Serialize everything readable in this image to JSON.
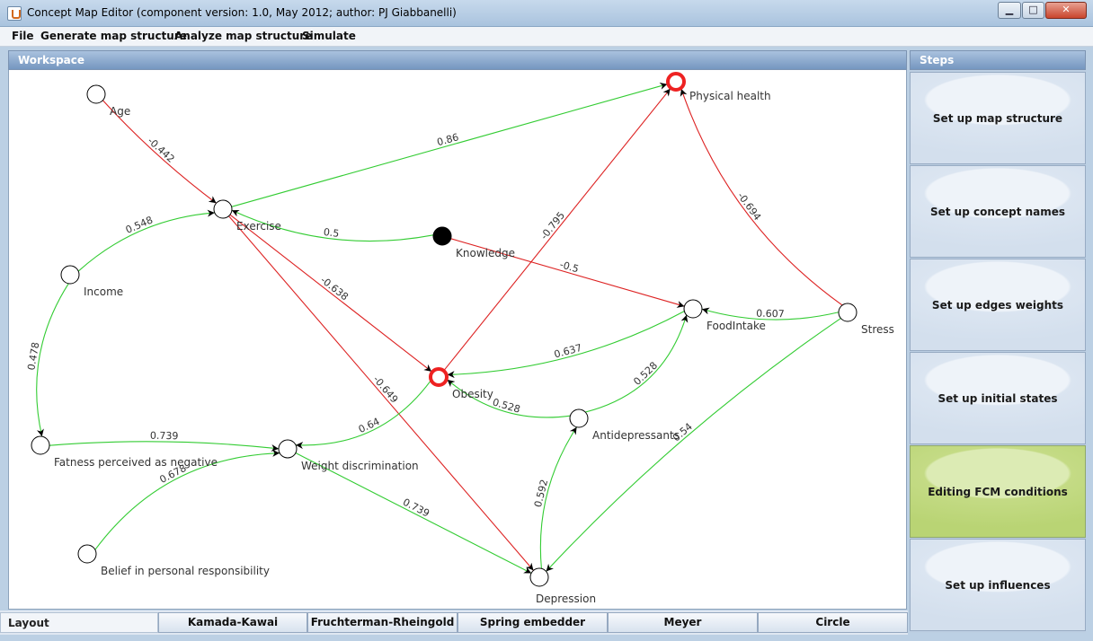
{
  "window": {
    "title": "Concept Map Editor (component version: 1.0, May 2012; author: PJ Giabbanelli)",
    "minimize_glyph": "▁",
    "maximize_glyph": "□",
    "close_glyph": "✕"
  },
  "menu": [
    "File",
    "Generate map structure",
    "Analyze map structure",
    "Simulate"
  ],
  "workspace": {
    "title": "Workspace"
  },
  "steps": {
    "title": "Steps",
    "items": [
      {
        "label": "Set up map structure",
        "active": false
      },
      {
        "label": "Set up concept names",
        "active": false
      },
      {
        "label": "Set up edges weights",
        "active": false
      },
      {
        "label": "Set up initial states",
        "active": false
      },
      {
        "label": "Editing FCM conditions",
        "active": true
      },
      {
        "label": "Set up influences",
        "active": false
      }
    ]
  },
  "layout": {
    "label": "Layout",
    "buttons": [
      "Kamada-Kawai",
      "Fruchterman-Rheingold",
      "Spring embedder",
      "Meyer",
      "Circle"
    ]
  },
  "colors": {
    "positive_edge": "#33cc33",
    "negative_edge": "#dd2222",
    "highlight_node": "#ee2222",
    "active_step": "#c4db85"
  },
  "concept_map": {
    "nodes": [
      {
        "id": "age",
        "label": "Age",
        "style": "normal"
      },
      {
        "id": "exercise",
        "label": "Exercise",
        "style": "normal"
      },
      {
        "id": "income",
        "label": "Income",
        "style": "normal"
      },
      {
        "id": "knowledge",
        "label": "Knowledge",
        "style": "filled"
      },
      {
        "id": "physical_health",
        "label": "Physical health",
        "style": "highlight"
      },
      {
        "id": "foodintake",
        "label": "FoodIntake",
        "style": "normal"
      },
      {
        "id": "stress",
        "label": "Stress",
        "style": "normal"
      },
      {
        "id": "obesity",
        "label": "Obesity",
        "style": "highlight"
      },
      {
        "id": "antidepressants",
        "label": "Antidepressants",
        "style": "normal"
      },
      {
        "id": "fatness",
        "label": "Fatness perceived as negative",
        "style": "normal"
      },
      {
        "id": "weight_discrimination",
        "label": "Weight discrimination",
        "style": "normal"
      },
      {
        "id": "belief",
        "label": "Belief in personal responsibility",
        "style": "normal"
      },
      {
        "id": "depression",
        "label": "Depression",
        "style": "normal"
      }
    ],
    "edges": [
      {
        "from": "age",
        "to": "exercise",
        "weight": "-0.442",
        "sign": "negative"
      },
      {
        "from": "exercise",
        "to": "physical_health",
        "weight": "0.86",
        "sign": "positive"
      },
      {
        "from": "knowledge",
        "to": "exercise",
        "weight": "0.5",
        "sign": "positive"
      },
      {
        "from": "income",
        "to": "exercise",
        "weight": "0.548",
        "sign": "positive"
      },
      {
        "from": "income",
        "to": "fatness",
        "weight": "0.478",
        "sign": "positive"
      },
      {
        "from": "exercise",
        "to": "obesity",
        "weight": "-0.638",
        "sign": "negative"
      },
      {
        "from": "exercise",
        "to": "depression",
        "weight": "-0.649",
        "sign": "negative"
      },
      {
        "from": "obesity",
        "to": "physical_health",
        "weight": "-0.795",
        "sign": "negative"
      },
      {
        "from": "stress",
        "to": "physical_health",
        "weight": "-0.694",
        "sign": "negative"
      },
      {
        "from": "knowledge",
        "to": "foodintake",
        "weight": "-0.5",
        "sign": "negative"
      },
      {
        "from": "stress",
        "to": "foodintake",
        "weight": "0.607",
        "sign": "positive"
      },
      {
        "from": "foodintake",
        "to": "obesity",
        "weight": "0.637",
        "sign": "positive"
      },
      {
        "from": "antidepressants",
        "to": "foodintake",
        "weight": "0.528",
        "sign": "positive"
      },
      {
        "from": "antidepressants",
        "to": "obesity",
        "weight": "0.528",
        "sign": "positive"
      },
      {
        "from": "obesity",
        "to": "weight_discrimination",
        "weight": "0.64",
        "sign": "positive"
      },
      {
        "from": "fatness",
        "to": "weight_discrimination",
        "weight": "0.739",
        "sign": "positive"
      },
      {
        "from": "belief",
        "to": "weight_discrimination",
        "weight": "0.678",
        "sign": "positive"
      },
      {
        "from": "weight_discrimination",
        "to": "depression",
        "weight": "0.739",
        "sign": "positive"
      },
      {
        "from": "depression",
        "to": "antidepressants",
        "weight": "0.592",
        "sign": "positive"
      },
      {
        "from": "stress",
        "to": "depression",
        "weight": "0.54",
        "sign": "positive"
      }
    ]
  }
}
